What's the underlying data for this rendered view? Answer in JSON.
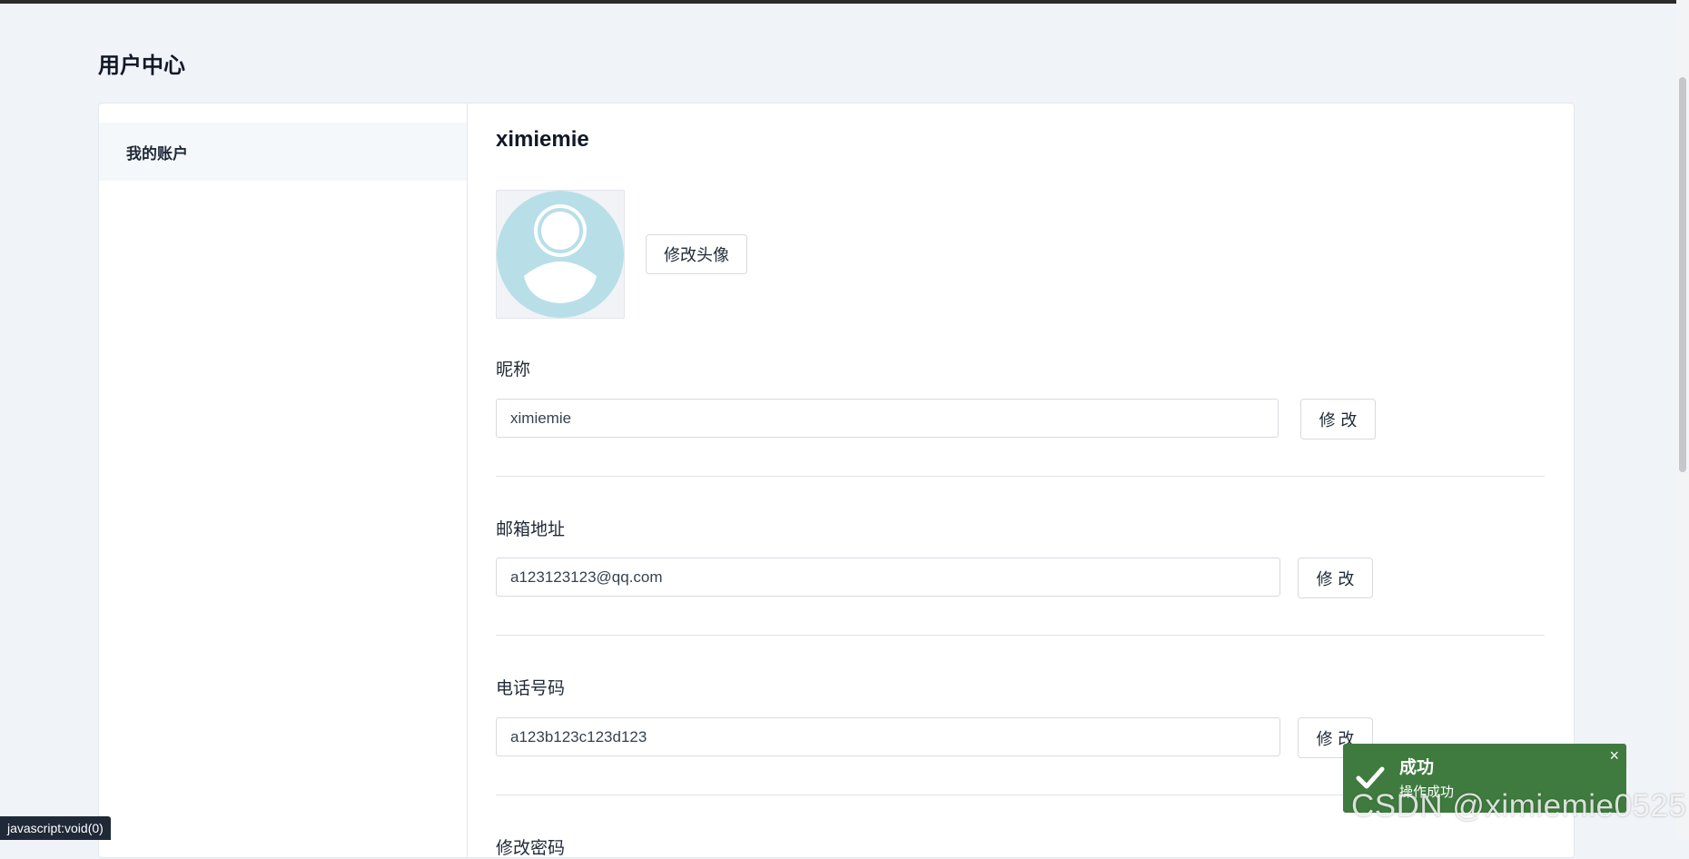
{
  "page": {
    "title": "用户中心"
  },
  "sidebar": {
    "items": [
      {
        "label": "我的账户"
      }
    ]
  },
  "profile": {
    "username": "ximiemie",
    "avatar_button": "修改头像",
    "fields": [
      {
        "label": "昵称",
        "value": "ximiemie",
        "button": "修 改"
      },
      {
        "label": "邮箱地址",
        "value": "a123123123@qq.com",
        "button": "修 改"
      },
      {
        "label": "电话号码",
        "value": "a123b123c123d123",
        "button": "修 改"
      }
    ],
    "next_label_partial": "修改密码"
  },
  "toast": {
    "title": "成功",
    "message": "操作成功",
    "close": "×"
  },
  "status_bar": {
    "text": "javascript:void(0)"
  },
  "watermark": {
    "text": "CSDN @ximiemie0525"
  },
  "colors": {
    "page_bg": "#f0f3f8",
    "avatar_placeholder": "#b8dfe8",
    "toast_success": "#3f7b3f"
  }
}
